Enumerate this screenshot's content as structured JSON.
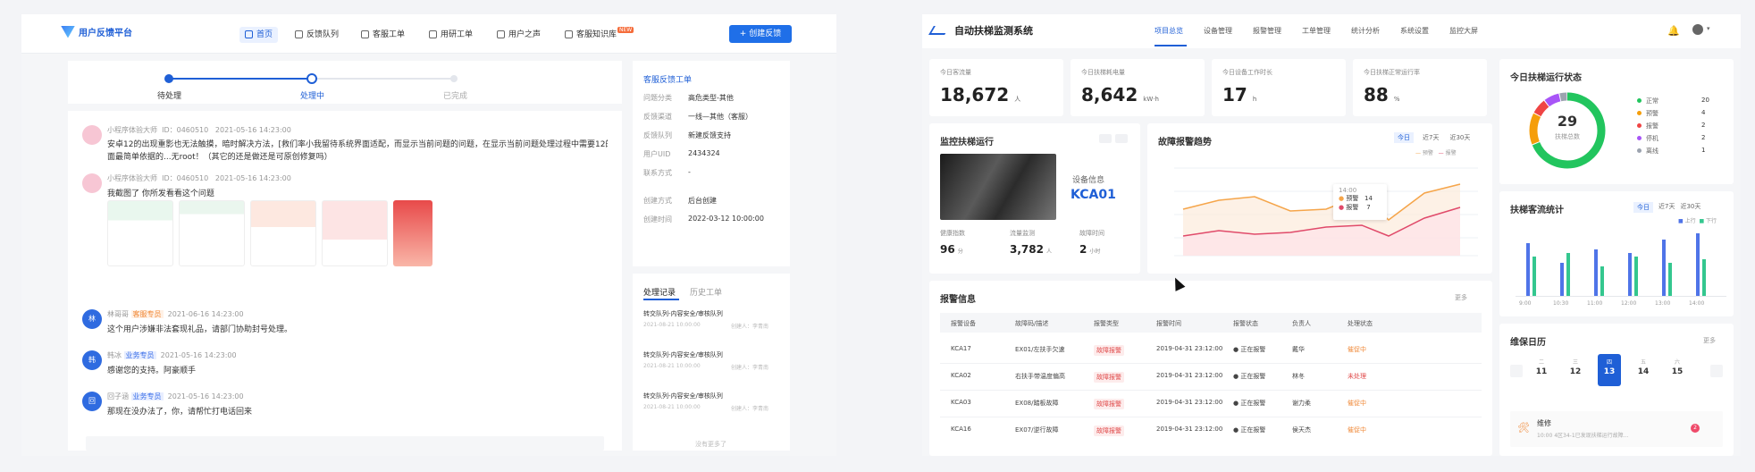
{
  "left": {
    "brand": "用户反馈平台",
    "nav": [
      {
        "label": "首页",
        "active": true
      },
      {
        "label": "反馈队列"
      },
      {
        "label": "客服工单"
      },
      {
        "label": "用研工单"
      },
      {
        "label": "用户之声"
      },
      {
        "label": "客服知识库",
        "badge": "NEW"
      }
    ],
    "create_button": "创建反馈",
    "steps": [
      "待处理",
      "处理中",
      "已完成"
    ],
    "messages": [
      {
        "name": "小程序体验大师",
        "id": "ID：0460510",
        "time": "2021-05-16 14:23:00",
        "text1": "安卓12的出现重影也无法触摸，暗时解决方法，[救们率小我留待系统界面适配，而显示当前问题的问题，在显示当前问题处理过程中需要12的，操作上也有效果，显示当前问题",
        "text2": "面最简单依据的...无root！（其它的还是做还是可原创修复吗）"
      },
      {
        "name": "小程序体验大师",
        "id": "ID：0460510",
        "time": "2021-05-16 14:23:00",
        "text1": "我截图了 你所发看看这个问题"
      },
      {
        "name": "林哥哥",
        "tag": "客服专员",
        "time": "2021-06-16 14:23:00",
        "text1": "这个用户涉嫌非法套现礼品，请部门协助封号处理。"
      },
      {
        "name": "韩冰",
        "tag": "业务专员",
        "time": "2021-05-16 14:23:00",
        "text1": "感谢您的支持。阿豪顺手"
      },
      {
        "name": "回子涵",
        "tag": "业务专员",
        "time": "2021-05-16 14:23:00",
        "text1": "那现在没办法了，你，请帮忙打电话回来"
      }
    ],
    "ticket": {
      "title": "客服反馈工单",
      "rows": [
        {
          "k": "问题分类",
          "v": "高危类型-其他"
        },
        {
          "k": "反馈渠道",
          "v": "一线—其他（客服）"
        },
        {
          "k": "反馈队列",
          "v": "新建反馈支持"
        },
        {
          "k": "用户UID",
          "v": "2434324"
        },
        {
          "k": "联系方式",
          "v": "-"
        },
        {
          "k": "创建方式",
          "v": "后台创建"
        },
        {
          "k": "创建时间",
          "v": "2022-03-12 10:00:00"
        }
      ]
    },
    "records": {
      "tabs": [
        "处理记录",
        "历史工单"
      ],
      "items": [
        {
          "title": "转交队列-内容安全/审核队列",
          "time": "2021-08-21 10:00:00",
          "who": "创建人：李青南"
        },
        {
          "title": "转交队列-内容安全/审核队列",
          "time": "2021-08-21 10:00:00",
          "who": "创建人：李青南"
        },
        {
          "title": "转交队列-内容安全/审核队列",
          "time": "2021-08-21 10:00:00",
          "who": "创建人：李青南"
        }
      ],
      "footer": "没有更多了"
    }
  },
  "right": {
    "brand": "自动扶梯监测系统",
    "nav": [
      "项目总览",
      "设备管理",
      "报警管理",
      "工单管理",
      "统计分析",
      "系统设置",
      "监控大屏"
    ],
    "kpis": [
      {
        "label": "今日客流量",
        "value": "18,672",
        "unit": "人"
      },
      {
        "label": "今日扶梯耗电量",
        "value": "8,642",
        "unit": "kW·h"
      },
      {
        "label": "今日设备工作时长",
        "value": "17",
        "unit": "h"
      },
      {
        "label": "今日扶梯正常运行率",
        "value": "88",
        "unit": "%"
      }
    ],
    "monitor": {
      "title": "监控扶梯运行",
      "device_label": "设备信息",
      "device_id": "KCA01",
      "stats": [
        {
          "label": "健康指数",
          "value": "96",
          "unit": "分"
        },
        {
          "label": "流量监测",
          "value": "3,782",
          "unit": "人"
        },
        {
          "label": "故障时间",
          "value": "2",
          "unit": "小时"
        }
      ]
    },
    "trend": {
      "title": "故障报警趋势",
      "tabs": [
        "今日",
        "近7天",
        "近30天"
      ],
      "legend": [
        "预警",
        "报警"
      ],
      "tooltip": {
        "time": "14:00",
        "rows": [
          {
            "k": "预警",
            "v": "14"
          },
          {
            "k": "报警",
            "v": "7"
          }
        ]
      }
    },
    "alarm": {
      "title": "报警信息",
      "more": "更多",
      "headers": [
        "报警设备",
        "故障码/描述",
        "报警类型",
        "报警时间",
        "报警状态",
        "负责人",
        "处理状态"
      ],
      "rows": [
        [
          "KCA17",
          "EX01/左扶手欠速",
          "故障报警",
          "2019-04-31  23:12:00",
          "● 正在报警",
          "戴华",
          "催促中"
        ],
        [
          "KCA02",
          "右扶手带温度偏高",
          "故障报警",
          "2019-04-31  23:12:00",
          "● 正在报警",
          "林冬",
          "未处理"
        ],
        [
          "KCA03",
          "EX08/踏板故障",
          "故障报警",
          "2019-04-31  23:12:00",
          "● 正在报警",
          "谢力柔",
          "催促中"
        ],
        [
          "KCA16",
          "EX07/逆行故障",
          "故障报警",
          "2019-04-31  23:12:00",
          "● 正在报警",
          "侯天杰",
          "催促中"
        ]
      ]
    },
    "status": {
      "title": "今日扶梯运行状态",
      "total": "29",
      "total_label": "扶梯总数",
      "items": [
        {
          "label": "正常",
          "value": "20",
          "color": "#22c55e"
        },
        {
          "label": "预警",
          "value": "4",
          "color": "#f59e0b"
        },
        {
          "label": "报警",
          "value": "2",
          "color": "#ef4444"
        },
        {
          "label": "停机",
          "value": "2",
          "color": "#a855f7"
        },
        {
          "label": "离线",
          "value": "1",
          "color": "#9ca3af"
        }
      ]
    },
    "traffic": {
      "title": "扶梯客流统计",
      "tabs": [
        "今日",
        "近7天",
        "近30天"
      ],
      "legend": [
        "上行",
        "下行"
      ],
      "x": [
        "9:00",
        "10:30",
        "11:00",
        "12:00",
        "13:00",
        "14:00"
      ],
      "series": [
        {
          "name": "上行",
          "color": "#4f74e8",
          "values": [
            32,
            20,
            28,
            26,
            34,
            38
          ]
        },
        {
          "name": "下行",
          "color": "#34c78f",
          "values": [
            24,
            26,
            18,
            24,
            20,
            22
          ]
        }
      ]
    },
    "calendar": {
      "title": "维保日历",
      "more": "更多",
      "days": [
        {
          "d": "11",
          "w": "二"
        },
        {
          "d": "12",
          "w": "三"
        },
        {
          "d": "13",
          "w": "四",
          "active": true
        },
        {
          "d": "14",
          "w": "五"
        },
        {
          "d": "15",
          "w": "六"
        }
      ],
      "event_title": "维修",
      "event_desc": "10:00  4区34-1已发现扶梯运行故障..."
    }
  }
}
